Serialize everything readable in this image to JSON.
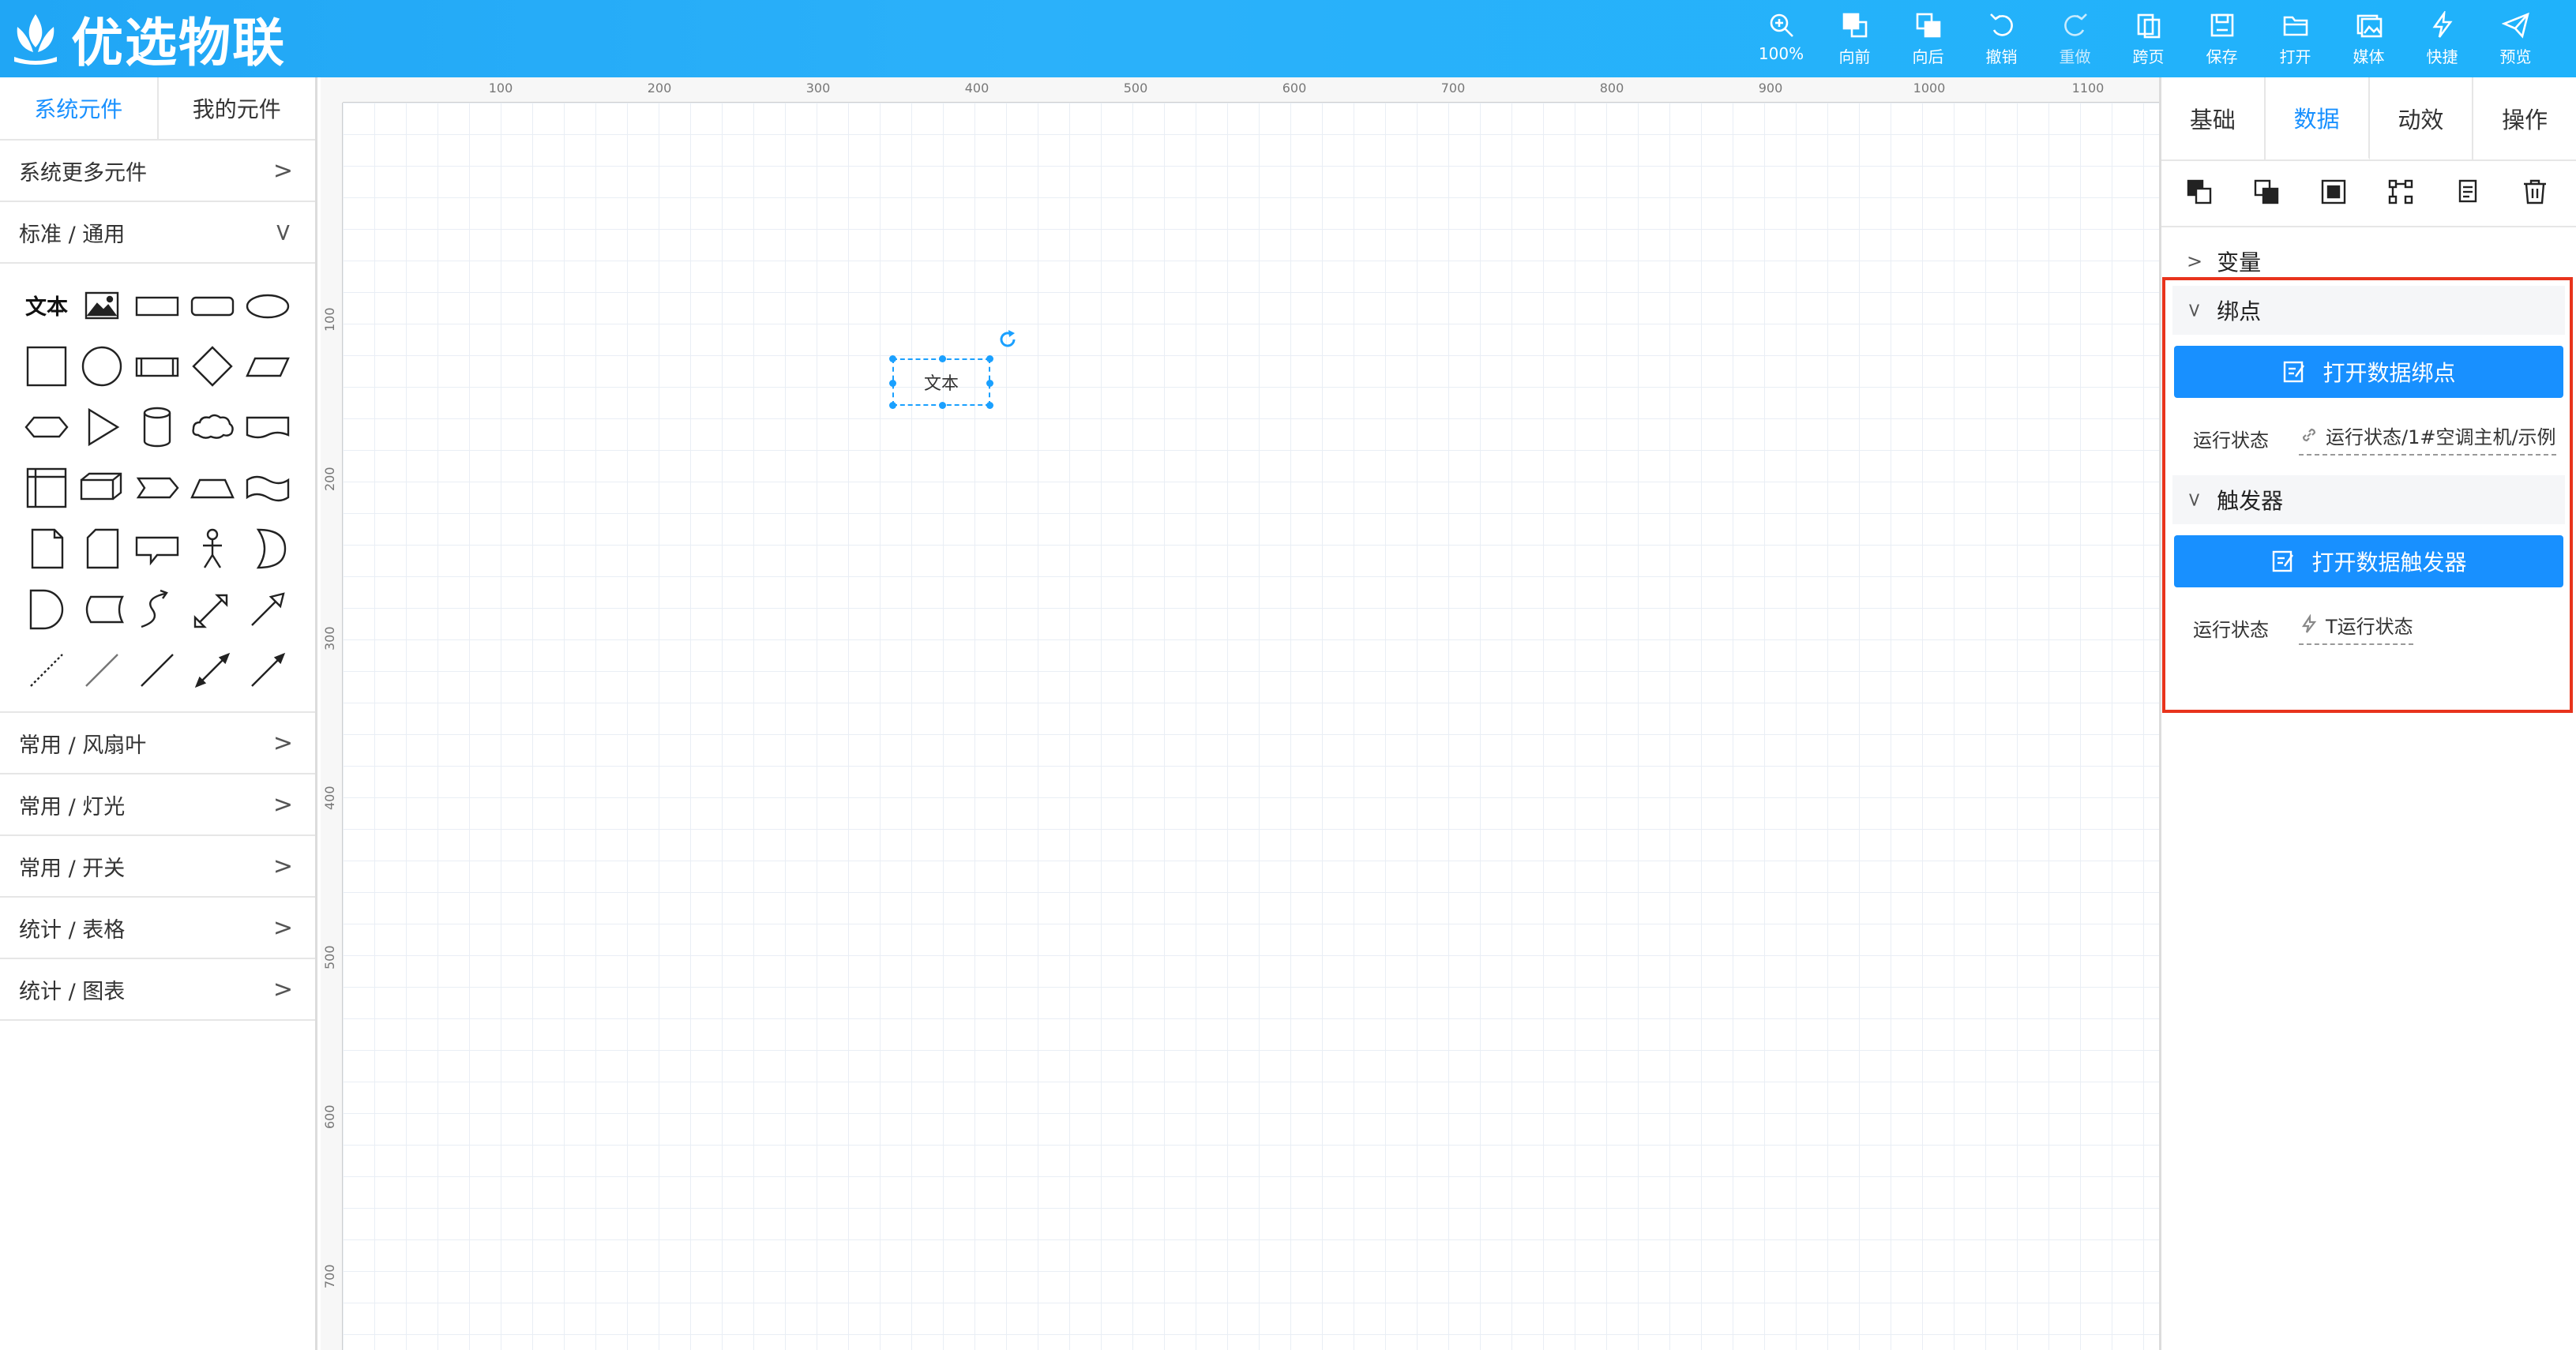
{
  "brand": {
    "name": "优选物联"
  },
  "toolbar": [
    {
      "icon": "zoom-in-icon",
      "label": "100%"
    },
    {
      "icon": "bring-forward-icon",
      "label": "向前"
    },
    {
      "icon": "send-backward-icon",
      "label": "向后"
    },
    {
      "icon": "undo-icon",
      "label": "撤销"
    },
    {
      "icon": "redo-icon",
      "label": "重做"
    },
    {
      "icon": "jump-page-icon",
      "label": "跨页"
    },
    {
      "icon": "save-icon",
      "label": "保存"
    },
    {
      "icon": "folder-open-icon",
      "label": "打开"
    },
    {
      "icon": "media-icon",
      "label": "媒体"
    },
    {
      "icon": "lightning-icon",
      "label": "快捷"
    },
    {
      "icon": "send-icon",
      "label": "预览"
    }
  ],
  "left_panel": {
    "tabs": [
      "系统元件",
      "我的元件"
    ],
    "more": "系统更多元件",
    "standard": "标准 / 通用",
    "text_shape": "文本",
    "categories": [
      "常用 / 风扇叶",
      "常用 / 灯光",
      "常用 / 开关",
      "统计 / 表格",
      "统计 / 图表"
    ]
  },
  "canvas": {
    "ruler_x": [
      "100",
      "200",
      "300",
      "400",
      "500",
      "600",
      "700",
      "800",
      "900",
      "1000",
      "1100"
    ],
    "ruler_y": [
      "100",
      "200",
      "300",
      "400",
      "500",
      "600",
      "700"
    ],
    "selected_text": "文本"
  },
  "right_panel": {
    "tabs": [
      "基础",
      "数据",
      "动效",
      "操作"
    ],
    "active_tab": "数据",
    "variable_section": "变量",
    "binding_section": "绑点",
    "binding_button": "打开数据绑点",
    "binding_key": "运行状态",
    "binding_value": "运行状态/1#空调主机/示例",
    "trigger_section": "触发器",
    "trigger_button": "打开数据触发器",
    "trigger_key": "运行状态",
    "trigger_value": "T运行状态"
  },
  "colors": {
    "accent": "#1890ff",
    "topbar": "#23a9f7",
    "highlight": "#e8331c"
  }
}
